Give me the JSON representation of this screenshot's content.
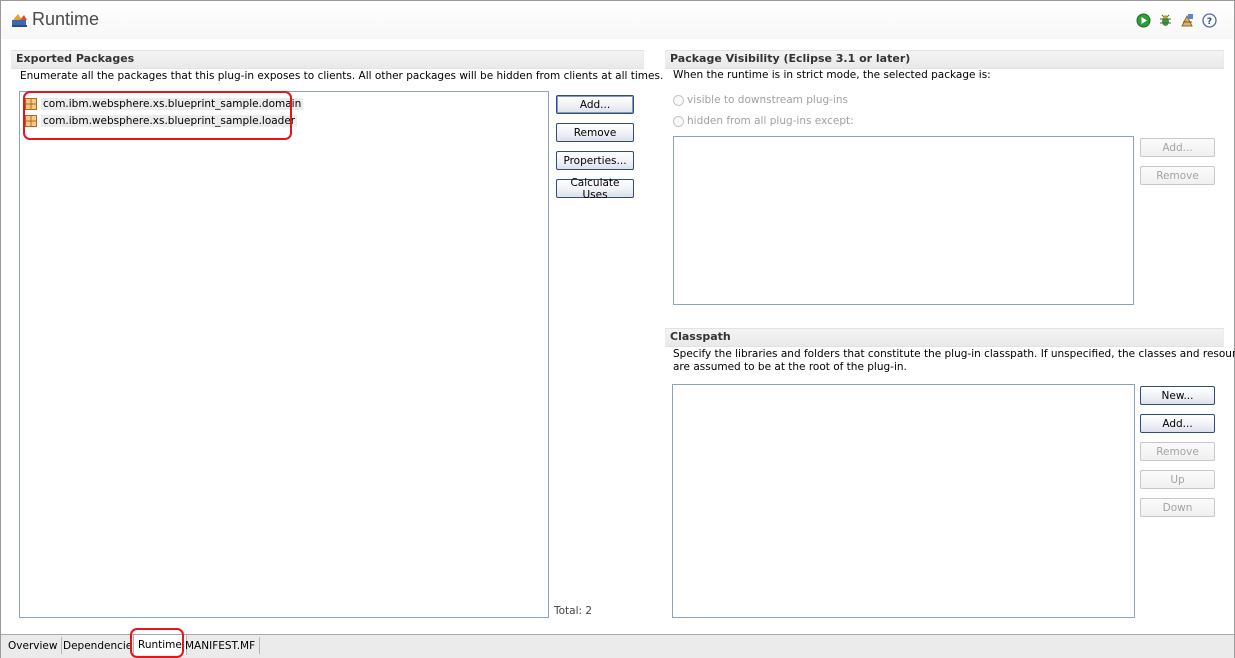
{
  "header": {
    "title": "Runtime",
    "icons": [
      "run-icon",
      "debug-icon",
      "export-icon",
      "help-icon"
    ]
  },
  "exported_packages": {
    "title": "Exported Packages",
    "description": "Enumerate all the packages that this plug-in exposes to clients.  All other packages will be hidden from clients at all times.",
    "items": [
      {
        "label": "com.ibm.websphere.xs.blueprint_sample.domain",
        "icon": "package-icon"
      },
      {
        "label": "com.ibm.websphere.xs.blueprint_sample.loader",
        "icon": "package-icon"
      }
    ],
    "buttons": {
      "add": "Add...",
      "remove": "Remove",
      "properties": "Properties...",
      "calculate_uses": "Calculate Uses"
    },
    "total": "Total: 2"
  },
  "package_visibility": {
    "title": "Package Visibility (Eclipse 3.1 or later)",
    "description": "When the runtime is in strict mode, the selected package is:",
    "radio_visible": "visible to downstream plug-ins",
    "radio_hidden": "hidden from all plug-ins except:",
    "buttons": {
      "add": "Add...",
      "remove": "Remove"
    }
  },
  "classpath": {
    "title": "Classpath",
    "description_line1": "Specify the libraries and folders that constitute the plug-in classpath.  If unspecified, the classes and resources",
    "description_line2": "are assumed to be at the root of the plug-in.",
    "buttons": {
      "new": "New...",
      "add": "Add...",
      "remove": "Remove",
      "up": "Up",
      "down": "Down"
    }
  },
  "tabs": [
    {
      "label": "Overview"
    },
    {
      "label": "Dependencies"
    },
    {
      "label": "Runtime",
      "active": true
    },
    {
      "label": "MANIFEST.MF"
    }
  ],
  "colors": {
    "highlight": "#e8141b",
    "button_border": "#314d7a",
    "list_border": "#8fa2b8"
  }
}
